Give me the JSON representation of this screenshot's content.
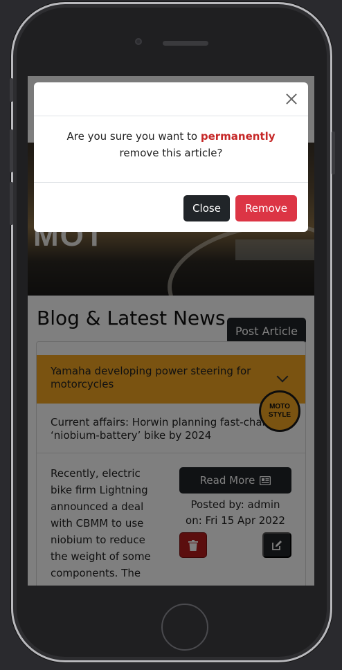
{
  "page": {
    "hero_text": "MOT",
    "title": "Blog & Latest News",
    "post_button": "Post Article",
    "accordion": [
      {
        "title": "Yamaha developing power steering for motorcycles",
        "active": true
      },
      {
        "title": "Current affairs: Horwin planning fast-charging ‘niobium-battery’ bike by 2024",
        "active": false
      }
    ],
    "badge": {
      "line1": "MOTO",
      "line2": "STYLE"
    },
    "article": {
      "body": "Recently, electric bike firm Lightning announced a deal with CBMM to use niobium to reduce the weight of some components. The",
      "read_more": "Read More",
      "posted_by": "Posted by: admin",
      "posted_on": "on: Fri 15 Apr 2022"
    }
  },
  "modal": {
    "message_before": "Are you sure you want to",
    "message_emphasis": "permanently",
    "message_after": "remove this article?",
    "close_button": "Close",
    "remove_button": "Remove"
  },
  "colors": {
    "accent": "#f5a623",
    "danger": "#dc3545",
    "dark": "#212529",
    "emphasis": "#c62828"
  }
}
